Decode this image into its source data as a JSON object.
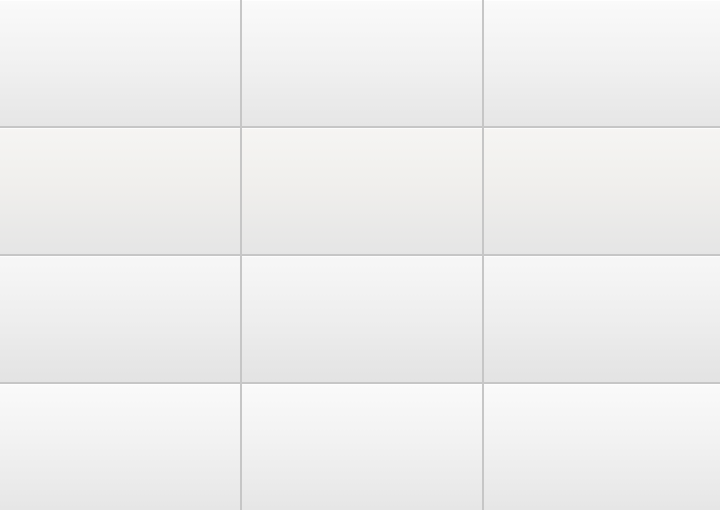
{
  "app": {
    "title": ""
  },
  "grid": {
    "rows": 4,
    "columns": 3,
    "tiles": [
      {
        "id": "r1c1",
        "label": ""
      },
      {
        "id": "r1c2",
        "label": ""
      },
      {
        "id": "r1c3",
        "label": ""
      },
      {
        "id": "r2c1",
        "label": ""
      },
      {
        "id": "r2c2",
        "label": ""
      },
      {
        "id": "r2c3",
        "label": ""
      },
      {
        "id": "r3c1",
        "label": ""
      },
      {
        "id": "r3c2",
        "label": ""
      },
      {
        "id": "r3c3",
        "label": ""
      },
      {
        "id": "r4c1",
        "label": ""
      },
      {
        "id": "r4c2",
        "label": ""
      },
      {
        "id": "r4c3",
        "label": ""
      }
    ]
  },
  "colors": {
    "tile_top": "#fafafa",
    "tile_bottom": "#e6e6e6",
    "divider": "#c6c6c6"
  }
}
